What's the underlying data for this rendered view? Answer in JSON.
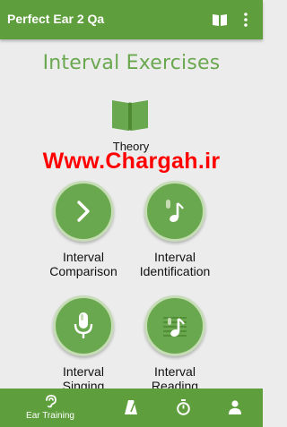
{
  "app_bar": {
    "title": "Perfect Ear 2 Qa",
    "book_icon": "open-book-icon",
    "more_icon": "more-vert-icon"
  },
  "page_title": "Interval Exercises",
  "theory": {
    "label": "Theory",
    "icon": "open-book-icon"
  },
  "watermark": "Www.Chargah.ir",
  "exercises": [
    {
      "line1": "Interval",
      "line2": "Comparison",
      "icon": "chevron-right-icon"
    },
    {
      "line1": "Interval",
      "line2": "Identification",
      "icon": "note-identify-icon"
    },
    {
      "line1": "Interval",
      "line2": "Singing",
      "icon": "microphone-note-icon"
    },
    {
      "line1": "Interval",
      "line2": "Reading",
      "icon": "staff-note-icon"
    }
  ],
  "bottom_nav": {
    "ear_training_label": "Ear Training",
    "items": [
      "ear-icon",
      "metronome-icon",
      "stopwatch-icon",
      "person-icon"
    ]
  },
  "colors": {
    "primary": "#5e9e3c",
    "accent": "#6aa84f",
    "background": "#ececec",
    "watermark": "#ff0000"
  }
}
